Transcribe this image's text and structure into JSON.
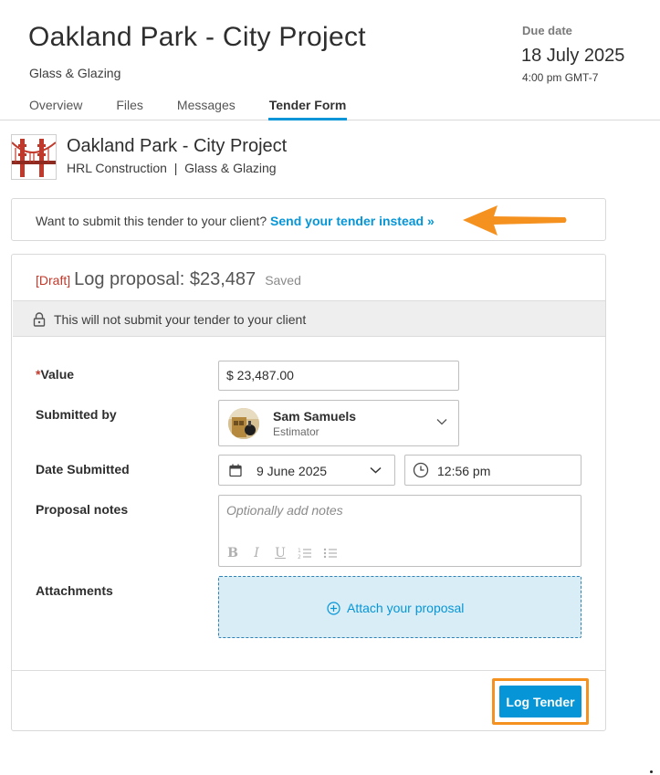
{
  "header": {
    "project_title": "Oakland Park - City Project",
    "trade": "Glass & Glazing",
    "due_label": "Due date",
    "due_date": "18 July 2025",
    "due_time": "4:00 pm GMT-7"
  },
  "tabs": [
    {
      "label": "Overview",
      "active": false
    },
    {
      "label": "Files",
      "active": false
    },
    {
      "label": "Messages",
      "active": false
    },
    {
      "label": "Tender Form",
      "active": true
    }
  ],
  "company": {
    "name": "Oakland Park - City Project",
    "subtitle": "HRL Construction  |  Glass & Glazing",
    "logo_icon": "golden-gate-bridge-icon"
  },
  "send_box": {
    "prompt": "Want to submit this tender to your client?",
    "link": "Send your tender instead »"
  },
  "proposal": {
    "draft_tag": "[Draft]",
    "title": "Log proposal: $23,487",
    "saved": "Saved",
    "notice": "This will not submit your tender to your client",
    "fields": {
      "value_label": "Value",
      "value_required": "*",
      "value": "$ 23,487.00",
      "submitted_by_label": "Submitted by",
      "user_name": "Sam Samuels",
      "user_role": "Estimator",
      "date_label": "Date Submitted",
      "date": "9 June 2025",
      "time": "12:56 pm",
      "notes_label": "Proposal notes",
      "notes_placeholder": "Optionally add notes",
      "attachments_label": "Attachments",
      "attach_text": "Attach your proposal"
    },
    "submit_label": "Log Tender"
  },
  "colors": {
    "accent": "#0696d7",
    "highlight": "#f5911f",
    "required": "#c0392b"
  }
}
